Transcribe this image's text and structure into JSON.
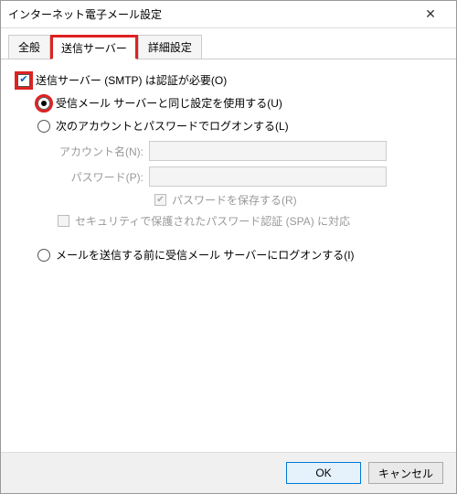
{
  "window": {
    "title": "インターネット電子メール設定"
  },
  "tabs": {
    "general": "全般",
    "outgoing": "送信サーバー",
    "advanced": "詳細設定"
  },
  "auth": {
    "checkbox_label": "送信サーバー (SMTP) は認証が必要(O)",
    "radio_same": "受信メール サーバーと同じ設定を使用する(U)",
    "radio_custom": "次のアカウントとパスワードでログオンする(L)",
    "account_label": "アカウント名(N):",
    "password_label": "パスワード(P):",
    "save_password": "パスワードを保存する(R)",
    "spa_label": "セキュリティで保護されたパスワード認証 (SPA) に対応",
    "radio_pop_before": "メールを送信する前に受信メール サーバーにログオンする(I)"
  },
  "buttons": {
    "ok": "OK",
    "cancel": "キャンセル"
  }
}
